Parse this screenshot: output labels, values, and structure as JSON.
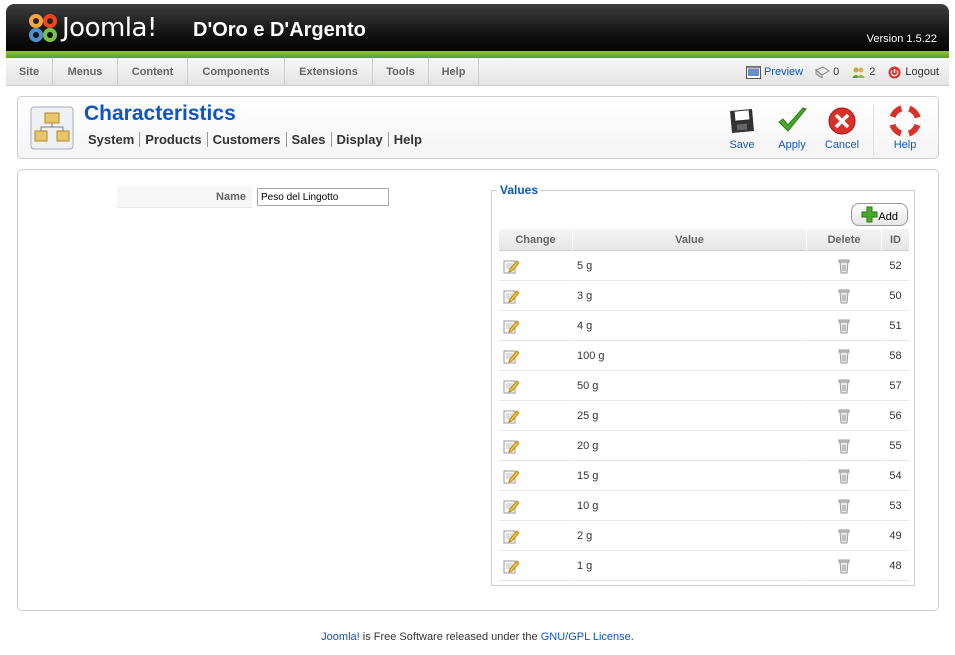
{
  "header": {
    "logo_text": "Joomla!",
    "site_title": "D'Oro e D'Argento",
    "version": "Version 1.5.22"
  },
  "menu": {
    "items": [
      {
        "label": "Site"
      },
      {
        "label": "Menus"
      },
      {
        "label": "Content"
      },
      {
        "label": "Components"
      },
      {
        "label": "Extensions"
      },
      {
        "label": "Tools"
      },
      {
        "label": "Help"
      }
    ]
  },
  "status": {
    "preview_label": "Preview",
    "messages_count": "0",
    "users_count": "2",
    "logout_label": "Logout"
  },
  "toolbar": {
    "title": "Characteristics",
    "submenu": [
      "System",
      "Products",
      "Customers",
      "Sales",
      "Display",
      "Help"
    ],
    "save_label": "Save",
    "apply_label": "Apply",
    "cancel_label": "Cancel",
    "help_label": "Help"
  },
  "form": {
    "name_label": "Name",
    "name_value": "Peso del Lingotto"
  },
  "values": {
    "legend": "Values",
    "add_label": "Add",
    "columns": {
      "change": "Change",
      "value": "Value",
      "delete": "Delete",
      "id": "ID"
    },
    "rows": [
      {
        "value": "5 g",
        "id": "52"
      },
      {
        "value": "3 g",
        "id": "50"
      },
      {
        "value": "4 g",
        "id": "51"
      },
      {
        "value": "100 g",
        "id": "58"
      },
      {
        "value": "50 g",
        "id": "57"
      },
      {
        "value": "25 g",
        "id": "56"
      },
      {
        "value": "20 g",
        "id": "55"
      },
      {
        "value": "15 g",
        "id": "54"
      },
      {
        "value": "10 g",
        "id": "53"
      },
      {
        "value": "2 g",
        "id": "49"
      },
      {
        "value": "1 g",
        "id": "48"
      }
    ]
  },
  "footer": {
    "joomla_link": "Joomla!",
    "middle_text": " is Free Software released under the ",
    "license_link": "GNU/GPL License",
    "end_text": "."
  },
  "colors": {
    "accent_blue": "#0b55c4",
    "brand_green": "#8cc63f"
  }
}
